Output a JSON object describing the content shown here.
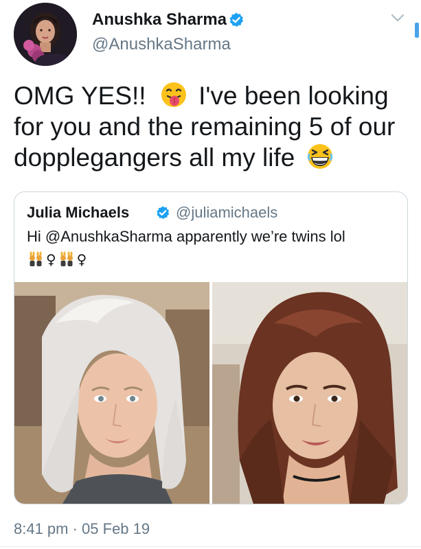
{
  "tweet": {
    "author": {
      "display_name": "Anushka Sharma",
      "handle": "@AnushkaSharma",
      "verified": true
    },
    "text_lines": [
      "OMG YES!!",
      "I've been looking",
      "for you and the remaining 5 of our",
      "dopplegangers all my life"
    ],
    "emojis": [
      "face-with-tongue-emoji",
      "grinning-squinting-face-emoji"
    ],
    "timestamp": "8:41 pm · 05 Feb 19"
  },
  "quoted_tweet": {
    "display_name": "Julia Michaels",
    "handle": "@juliamichaels",
    "verified": true,
    "text": "Hi @AnushkaSharma apparently we’re twins lol",
    "emoji_row": [
      "women-with-bunny-ears-icon",
      "♀",
      "women-with-bunny-ears-icon",
      "♀"
    ],
    "photos": [
      "blonde-woman-selfie-photo",
      "brunette-woman-selfie-photo"
    ]
  },
  "colors": {
    "text": "#14171a",
    "secondary_text": "#657786",
    "verified_blue": "#1da1f2",
    "card_border": "#ccd6dd",
    "scroll_indicator": "#4aa3e8"
  }
}
